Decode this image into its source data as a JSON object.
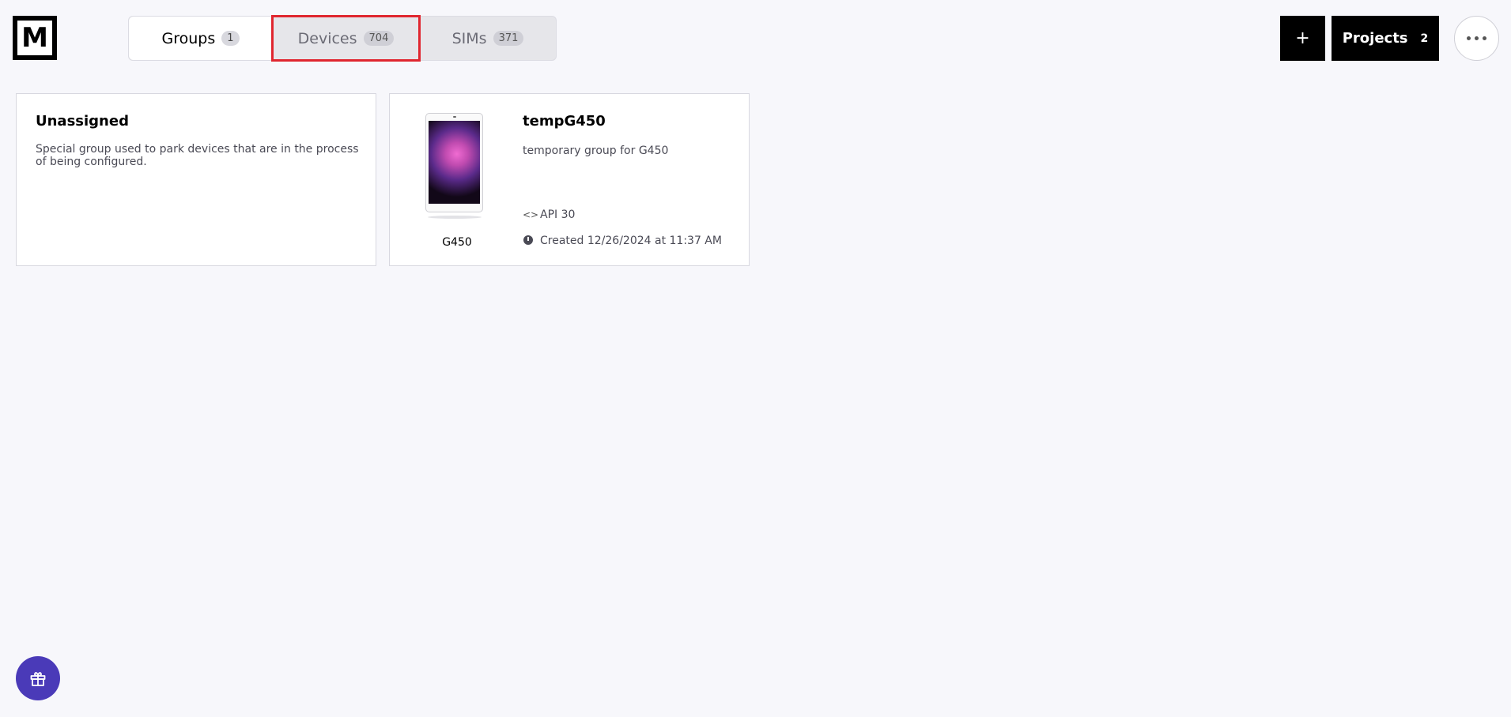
{
  "logo": {
    "letter": "M"
  },
  "tabs": [
    {
      "label": "Groups",
      "count": "1"
    },
    {
      "label": "Devices",
      "count": "704"
    },
    {
      "label": "SIMs",
      "count": "371"
    }
  ],
  "header": {
    "add_label": "+",
    "projects_label": "Projects",
    "projects_count": "2"
  },
  "groups": [
    {
      "title": "Unassigned",
      "description": "Special group used to park devices that are in the process of being configured."
    },
    {
      "title": "tempG450",
      "description": "temporary group for G450",
      "device_model": "G450",
      "api": "API 30",
      "created": "Created 12/26/2024 at 11:37 AM"
    }
  ],
  "icons": {
    "code": "code-icon",
    "clock": "clock-icon",
    "gift": "gift-icon",
    "more": "more-horizontal-icon"
  },
  "colors": {
    "accent_red": "#e0262f",
    "gift_purple": "#4a3ab8",
    "background": "#f7f7fb"
  }
}
